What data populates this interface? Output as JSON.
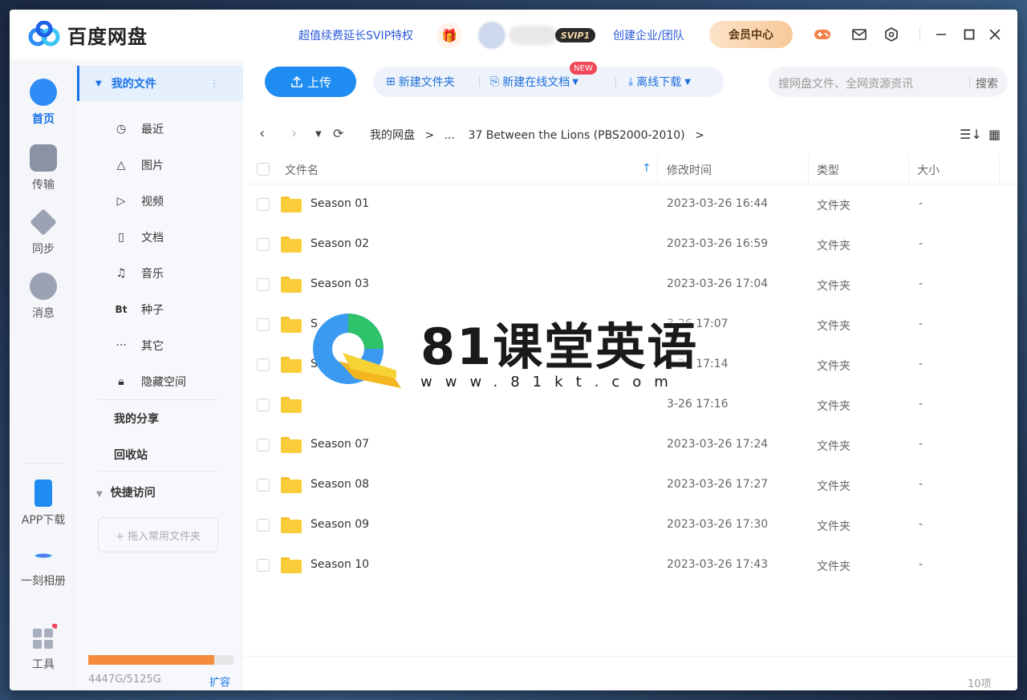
{
  "app": {
    "logo_text": "百度网盘",
    "promo_text": "超值续费延长SVIP特权",
    "svip_badge": "SVIP1",
    "team_link": "创建企业/团队",
    "vip_center": "会员中心"
  },
  "rail": {
    "home": "首页",
    "transfer": "传输",
    "sync": "同步",
    "messages": "消息",
    "app_download": "APP下载",
    "moment_album": "一刻相册",
    "tools": "工具"
  },
  "nav": {
    "my_files": "我的文件",
    "recent": "最近",
    "images": "图片",
    "video": "视频",
    "docs": "文档",
    "music": "音乐",
    "bt_icon": "Bt",
    "torrents": "种子",
    "other": "其它",
    "hidden": "隐藏空间",
    "my_share": "我的分享",
    "recycle": "回收站",
    "quick_access": "快捷访问",
    "drop_zone": "+ 拖入常用文件夹",
    "quota": "4447G/5125G",
    "quota_used_fraction": 0.868,
    "expand": "扩容"
  },
  "toolbar": {
    "upload": "上传",
    "new_folder": "新建文件夹",
    "new_online_doc": "新建在线文档",
    "new_badge": "NEW",
    "offline_download": "离线下载",
    "search_placeholder": "搜网盘文件、全网资源资讯",
    "search_button": "搜索"
  },
  "breadcrumb": {
    "root": "我的网盘",
    "sep": ">",
    "ellipsis": "...",
    "current": "37 Between the Lions (PBS2000-2010)"
  },
  "table": {
    "col_name": "文件名",
    "col_time": "修改时间",
    "col_type": "类型",
    "col_size": "大小",
    "rows": [
      {
        "name": "Season 01",
        "time": "2023-03-26 16:44",
        "type": "文件夹",
        "size": "-"
      },
      {
        "name": "Season 02",
        "time": "2023-03-26 16:59",
        "type": "文件夹",
        "size": "-"
      },
      {
        "name": "Season 03",
        "time": "2023-03-26 17:04",
        "type": "文件夹",
        "size": "-"
      },
      {
        "name": "S",
        "time": "3-26 17:07",
        "type": "文件夹",
        "size": "-"
      },
      {
        "name": "S",
        "time": "3-26 17:14",
        "type": "文件夹",
        "size": "-"
      },
      {
        "name": "",
        "time": "3-26 17:16",
        "type": "文件夹",
        "size": "-"
      },
      {
        "name": "Season 07",
        "time": "2023-03-26 17:24",
        "type": "文件夹",
        "size": "-"
      },
      {
        "name": "Season 08",
        "time": "2023-03-26 17:27",
        "type": "文件夹",
        "size": "-"
      },
      {
        "name": "Season 09",
        "time": "2023-03-26 17:30",
        "type": "文件夹",
        "size": "-"
      },
      {
        "name": "Season 10",
        "time": "2023-03-26 17:43",
        "type": "文件夹",
        "size": "-"
      }
    ],
    "item_count": "10项"
  },
  "watermark": {
    "title": "81课堂英语",
    "url": "www.81kt.com"
  }
}
